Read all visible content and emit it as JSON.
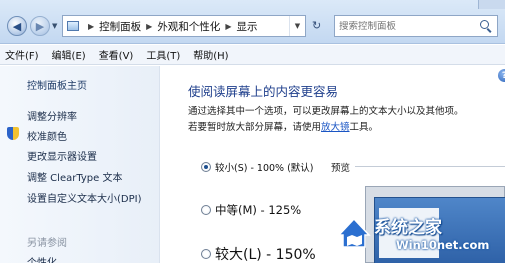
{
  "address_bar": {
    "breadcrumb": [
      "控制面板",
      "外观和个性化",
      "显示"
    ],
    "search_placeholder": "搜索控制面板"
  },
  "menubar": {
    "items": [
      "文件(F)",
      "编辑(E)",
      "查看(V)",
      "工具(T)",
      "帮助(H)"
    ]
  },
  "sidebar": {
    "home": "控制面板主页",
    "links": [
      "调整分辨率",
      "校准颜色",
      "更改显示器设置",
      "调整 ClearType 文本",
      "设置自定义文本大小(DPI)"
    ],
    "see_also": "另请参阅",
    "personalize": "个性化"
  },
  "main": {
    "help": "?",
    "title": "使阅读屏幕上的内容更容易",
    "desc_line1": "通过选择其中一个选项，可以更改屏幕上的文本大小以及其他项。",
    "desc_line2_pre": "若要暂时放大部分屏幕，请使用",
    "desc_line2_link": "放大镜",
    "desc_line2_post": "工具。",
    "options": [
      {
        "label": "较小(S) - 100% (默认)",
        "selected": true
      },
      {
        "label": "中等(M) - 125%",
        "selected": false
      },
      {
        "label": "较大(L) - 150%",
        "selected": false
      }
    ],
    "preview_label": "预览"
  },
  "watermark": {
    "title": "系统之家",
    "url": "Win10net.com"
  }
}
